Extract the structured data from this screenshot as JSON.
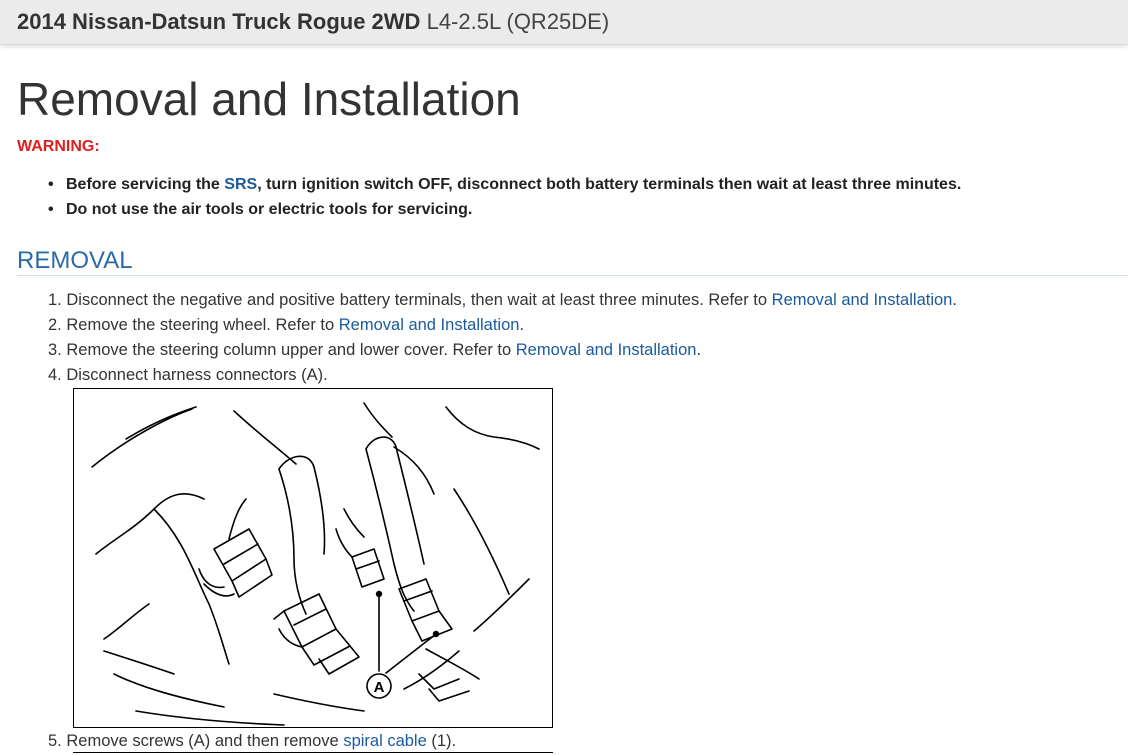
{
  "header": {
    "vehicle": "2014 Nissan-Datsun Truck Rogue 2WD",
    "engine": "L4-2.5L (QR25DE)"
  },
  "page_title": "Removal and Installation",
  "warning": {
    "label": "WARNING:",
    "items": [
      {
        "before": "Before servicing the ",
        "link": "SRS",
        "after": ", turn ignition switch OFF, disconnect both battery terminals then wait at least three minutes."
      },
      {
        "text": "Do not use the air tools or electric tools for servicing."
      }
    ]
  },
  "removal": {
    "heading": "REMOVAL",
    "steps": [
      {
        "num": "1.",
        "text": "Disconnect the negative and positive battery terminals, then wait at least three minutes. Refer to ",
        "link": "Removal and Installation",
        "after": "."
      },
      {
        "num": "2.",
        "text": "Remove the steering wheel. Refer to ",
        "link": "Removal and Installation",
        "after": "."
      },
      {
        "num": "3.",
        "text": "Remove the steering column upper and lower cover. Refer to ",
        "link": "Removal and Installation",
        "after": "."
      },
      {
        "num": "4.",
        "text": "Disconnect harness connectors (A).",
        "link": "",
        "after": ""
      }
    ],
    "figure_callout": "A",
    "step5": {
      "num": "5.",
      "text": "Remove screws (A) and then remove ",
      "link": "spiral cable",
      "after": " (1)."
    }
  }
}
